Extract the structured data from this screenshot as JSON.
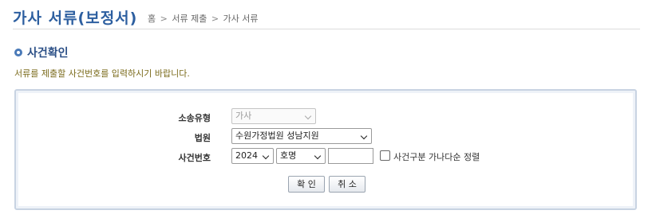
{
  "header": {
    "title": "가사 서류(보정서)",
    "breadcrumb": [
      "홈",
      "서류 제출",
      "가사 서류"
    ],
    "breadcrumb_separator": ">"
  },
  "section": {
    "title": "사건확인",
    "instruction": "서류를 제출할 사건번호를 입력하시기 바랍니다."
  },
  "form": {
    "case_type": {
      "label": "소송유형",
      "value": "가사",
      "disabled": true
    },
    "court": {
      "label": "법원",
      "value": "수원가정법원 성남지원"
    },
    "case_number": {
      "label": "사건번호",
      "year": "2024",
      "category": "호명",
      "number": "",
      "sort_checkbox_label": "사건구분 가나다순 정렬",
      "sort_checked": false
    }
  },
  "buttons": {
    "confirm": "확 인",
    "cancel": "취 소"
  },
  "colors": {
    "title": "#2d5fa0",
    "section_title": "#2b4f86",
    "instruction": "#7a6a1a",
    "panel_border": "#c8d3e2"
  },
  "icons": {
    "section_bullet": "circle-bullet-icon",
    "select_arrow": "chevron-down-icon"
  }
}
